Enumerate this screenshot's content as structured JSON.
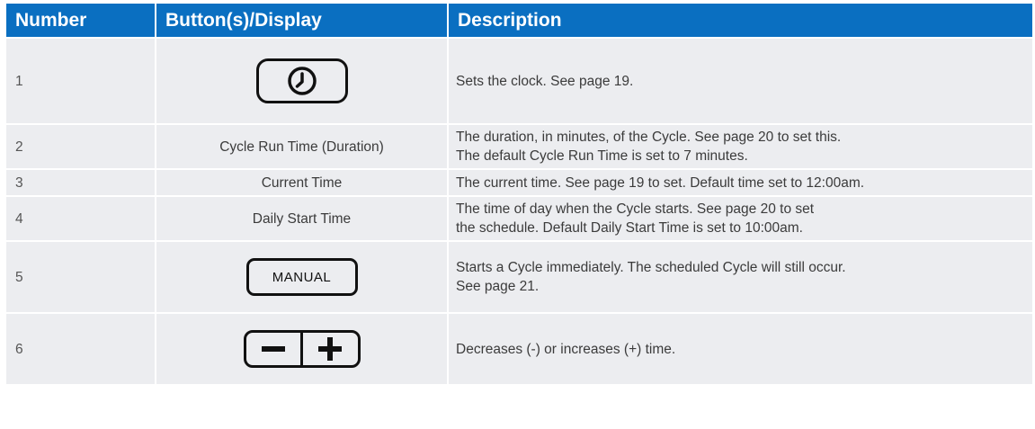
{
  "headers": {
    "number": "Number",
    "buttons": "Button(s)/Display",
    "description": "Description"
  },
  "rows": [
    {
      "number": "1",
      "display": "",
      "display_icon": "clock-icon",
      "description": [
        "Sets the clock. See page 19."
      ]
    },
    {
      "number": "2",
      "display": "Cycle Run Time (Duration)",
      "description": [
        "The duration, in minutes, of the Cycle. See page 20 to set this.",
        "The default Cycle Run Time is set to 7 minutes."
      ]
    },
    {
      "number": "3",
      "display": "Current Time",
      "description": [
        "The current time. See page 19 to set. Default time set to 12:00am."
      ]
    },
    {
      "number": "4",
      "display": "Daily Start Time",
      "description": [
        "The time of day when the Cycle starts. See page 20 to set",
        "the schedule. Default Daily Start Time is set to 10:00am."
      ]
    },
    {
      "number": "5",
      "display": "MANUAL",
      "display_icon": "manual-button",
      "description": [
        "Starts a Cycle immediately. The scheduled Cycle will still occur.",
        "See page 21."
      ]
    },
    {
      "number": "6",
      "display": "",
      "display_icon": "minus-plus-icon",
      "description": [
        "Decreases (-) or increases (+) time."
      ]
    }
  ],
  "colors": {
    "header_bg": "#0a6fc1",
    "row_bg": "#ecedf0",
    "text": "#3b3b3b",
    "icon_stroke": "#111111"
  }
}
